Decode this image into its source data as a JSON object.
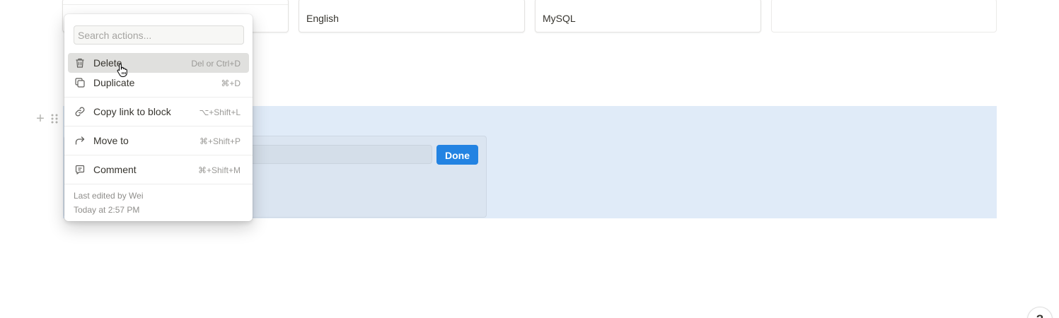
{
  "gallery": {
    "cards": [
      {
        "text": ""
      },
      {
        "text": "English"
      },
      {
        "text": "MySQL"
      },
      {
        "text": ""
      }
    ]
  },
  "embed": {
    "done_label": "Done"
  },
  "menu": {
    "search_placeholder": "Search actions...",
    "items": [
      {
        "label": "Delete",
        "shortcut": "Del or Ctrl+D",
        "icon": "trash-icon"
      },
      {
        "label": "Duplicate",
        "shortcut": "⌘+D",
        "icon": "duplicate-icon"
      },
      {
        "label": "Copy link to block",
        "shortcut": "⌥+Shift+L",
        "icon": "link-icon"
      },
      {
        "label": "Move to",
        "shortcut": "⌘+Shift+P",
        "icon": "move-arrow-icon"
      },
      {
        "label": "Comment",
        "shortcut": "⌘+Shift+M",
        "icon": "comment-icon"
      }
    ],
    "footer": {
      "edited_by": "Last edited by Wei",
      "edited_time": "Today at 2:57 PM"
    }
  },
  "help": {
    "label": "?"
  },
  "colors": {
    "accent": "#2383e2",
    "selection": "#e0ebf8",
    "hover": "#e0e0de"
  }
}
